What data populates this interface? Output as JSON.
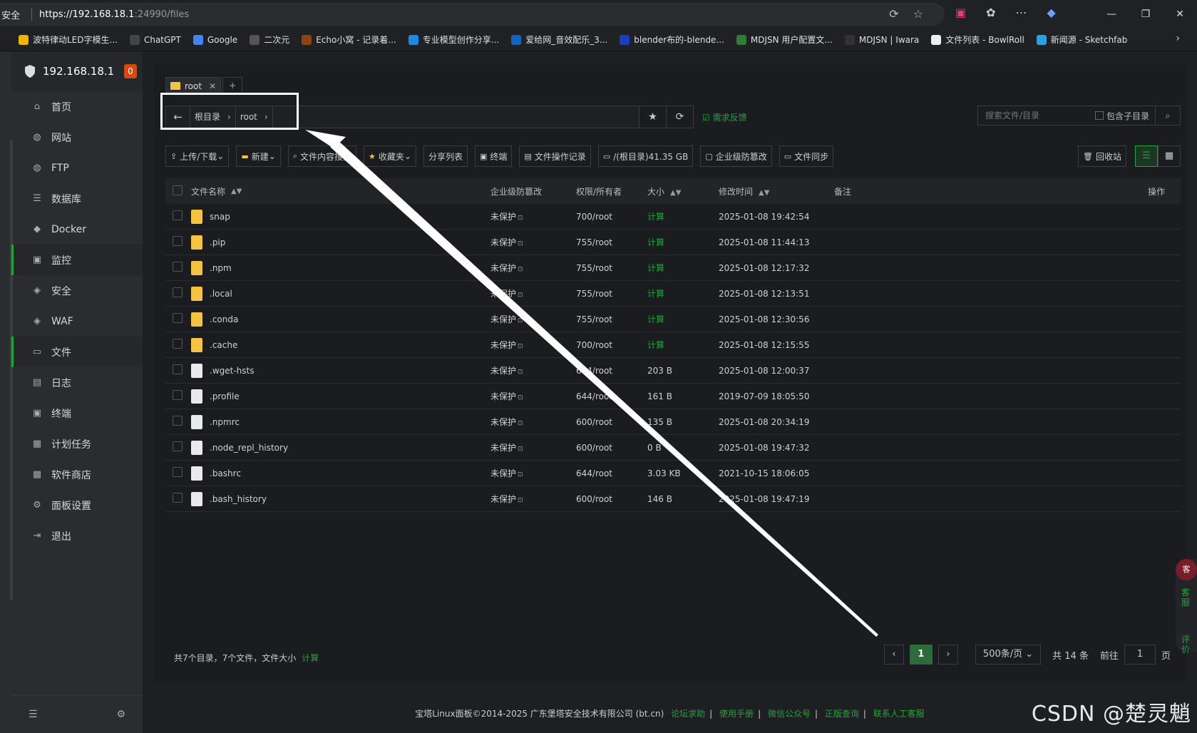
{
  "browser": {
    "security": "安全",
    "url_host": "https://192.168.18.1",
    "url_path": ":24990/files",
    "bookmarks": [
      {
        "label": "波特律动LED字模生...",
        "color": "#f0b400"
      },
      {
        "label": "ChatGPT",
        "color": "#444"
      },
      {
        "label": "Google",
        "color": "#4285f4"
      },
      {
        "label": "二次元",
        "color": "#555"
      },
      {
        "label": "Echo小窝 - 记录着...",
        "color": "#8b4513"
      },
      {
        "label": "专业模型创作分享...",
        "color": "#1e88e5"
      },
      {
        "label": "爱给网_音效配乐_3...",
        "color": "#1565c0"
      },
      {
        "label": "blender布的-blende...",
        "color": "#1a3fbf"
      },
      {
        "label": "MDJSN 用户配置文...",
        "color": "#2e7d32"
      },
      {
        "label": "MDJSN | Iwara",
        "color": "#333"
      },
      {
        "label": "文件列表 - BowlRoll",
        "color": "#eee"
      },
      {
        "label": "新闻源 - Sketchfab",
        "color": "#29a3e0"
      }
    ]
  },
  "sidebar": {
    "host": "192.168.18.1",
    "badge": "0",
    "items": [
      {
        "label": "首页",
        "icon": "home-icon",
        "glyph": "⌂"
      },
      {
        "label": "网站",
        "icon": "globe-icon",
        "glyph": "◍"
      },
      {
        "label": "FTP",
        "icon": "ftp-icon",
        "glyph": "◍"
      },
      {
        "label": "数据库",
        "icon": "database-icon",
        "glyph": "☰"
      },
      {
        "label": "Docker",
        "icon": "docker-icon",
        "glyph": "◆"
      },
      {
        "label": "监控",
        "icon": "monitor-icon",
        "glyph": "▣"
      },
      {
        "label": "安全",
        "icon": "shield-icon",
        "glyph": "◈"
      },
      {
        "label": "WAF",
        "icon": "waf-icon",
        "glyph": "◈"
      },
      {
        "label": "文件",
        "icon": "folder-icon",
        "glyph": "▭"
      },
      {
        "label": "日志",
        "icon": "log-icon",
        "glyph": "▤"
      },
      {
        "label": "终端",
        "icon": "terminal-icon",
        "glyph": "▣"
      },
      {
        "label": "计划任务",
        "icon": "cron-icon",
        "glyph": "▦"
      },
      {
        "label": "软件商店",
        "icon": "store-icon",
        "glyph": "▦"
      },
      {
        "label": "面板设置",
        "icon": "settings-icon",
        "glyph": "⚙"
      },
      {
        "label": "退出",
        "icon": "logout-icon",
        "glyph": "⇥"
      }
    ]
  },
  "tabs": {
    "root": "root",
    "add": "+"
  },
  "path": {
    "crumbs": [
      "根目录",
      "root"
    ],
    "feedback": "需求反馈",
    "search_placeholder": "搜索文件/目录",
    "include_sub": "包含子目录"
  },
  "toolbar": {
    "upload": "上传/下载",
    "new": "新建",
    "content_search": "文件内容搜索",
    "favorites": "收藏夹",
    "share_list": "分享列表",
    "terminal": "终端",
    "op_log": "文件操作记录",
    "disk": "/(根目录)41.35 GB",
    "tamper": "企业级防篡改",
    "sync": "文件同步",
    "recycle": "回收站"
  },
  "table": {
    "headers": {
      "name": "文件名称",
      "prot": "企业级防篡改",
      "perm": "权限/所有者",
      "size": "大小",
      "time": "修改时间",
      "note": "备注",
      "op": "操作"
    },
    "rows": [
      {
        "name": "snap",
        "type": "folder",
        "prot": "未保护",
        "perm": "700/root",
        "size": "计算",
        "time": "2025-01-08 19:42:54"
      },
      {
        "name": ".pip",
        "type": "folder",
        "prot": "未保护",
        "perm": "755/root",
        "size": "计算",
        "time": "2025-01-08 11:44:13"
      },
      {
        "name": ".npm",
        "type": "folder",
        "prot": "未保护",
        "perm": "755/root",
        "size": "计算",
        "time": "2025-01-08 12:17:32"
      },
      {
        "name": ".local",
        "type": "folder",
        "prot": "未保护",
        "perm": "755/root",
        "size": "计算",
        "time": "2025-01-08 12:13:51"
      },
      {
        "name": ".conda",
        "type": "folder",
        "prot": "未保护",
        "perm": "755/root",
        "size": "计算",
        "time": "2025-01-08 12:30:56"
      },
      {
        "name": ".cache",
        "type": "folder",
        "prot": "未保护",
        "perm": "700/root",
        "size": "计算",
        "time": "2025-01-08 12:15:55"
      },
      {
        "name": ".wget-hsts",
        "type": "file",
        "prot": "未保护",
        "perm": "644/root",
        "size": "203 B",
        "time": "2025-01-08 12:00:37"
      },
      {
        "name": ".profile",
        "type": "file",
        "prot": "未保护",
        "perm": "644/root",
        "size": "161 B",
        "time": "2019-07-09 18:05:50"
      },
      {
        "name": ".npmrc",
        "type": "file",
        "prot": "未保护",
        "perm": "600/root",
        "size": "135 B",
        "time": "2025-01-08 20:34:19"
      },
      {
        "name": ".node_repl_history",
        "type": "file",
        "prot": "未保护",
        "perm": "600/root",
        "size": "0 B",
        "time": "2025-01-08 19:47:32"
      },
      {
        "name": ".bashrc",
        "type": "file",
        "prot": "未保护",
        "perm": "644/root",
        "size": "3.03 KB",
        "time": "2021-10-15 18:06:05"
      },
      {
        "name": ".bash_history",
        "type": "file",
        "prot": "未保护",
        "perm": "600/root",
        "size": "146 B",
        "time": "2025-01-08 19:47:19"
      }
    ]
  },
  "footer_stat": {
    "text": "共7个目录，7个文件，文件大小",
    "calc": "计算"
  },
  "pager": {
    "current": "1",
    "page_size": "500条/页",
    "total": "共 14 条",
    "goto": "前往",
    "goto_value": "1",
    "page_unit": "页"
  },
  "page_footer": {
    "copyright": "宝塔Linux面板©2014-2025 广东堡塔安全技术有限公司 (bt.cn)",
    "links": [
      "论坛求助",
      "使用手册",
      "微信公众号",
      "正版查询",
      "联系人工客服"
    ]
  },
  "float": {
    "service": "客服",
    "review": "评价"
  },
  "watermark": "CSDN @楚灵魈",
  "colors": {
    "accent": "#20a53a",
    "folder": "#f5c241",
    "badge": "#d9480f"
  }
}
